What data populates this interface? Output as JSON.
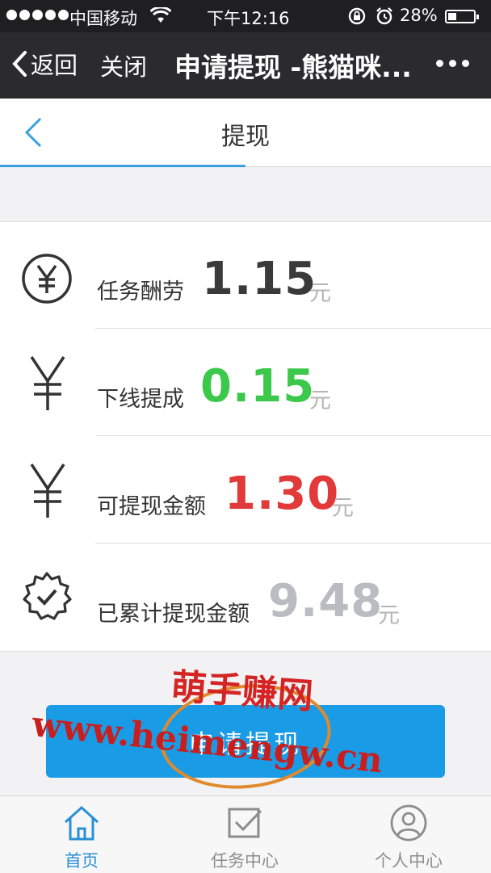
{
  "status_bar": {
    "carrier": "中国移动",
    "time": "下午12:16",
    "battery_percent": "28%",
    "battery_level": 0.28
  },
  "nav": {
    "back_label": "返回",
    "close_label": "关闭",
    "title": "申请提现 -熊猫咪..."
  },
  "page": {
    "title": "提现"
  },
  "rows": [
    {
      "label": "任务酬劳",
      "value": "1.15",
      "unit": "元",
      "icon": "yen-circle-icon",
      "color": "#3a3a3a"
    },
    {
      "label": "下线提成",
      "value": "0.15",
      "unit": "元",
      "icon": "yen-icon",
      "color": "#3cc84a"
    },
    {
      "label": "可提现金额",
      "value": "1.30",
      "unit": "元",
      "icon": "yen-icon",
      "color": "#e2393a"
    },
    {
      "label": "已累计提现金额",
      "value": "9.48",
      "unit": "元",
      "icon": "badge-check-icon",
      "color": "#b9bcc0"
    }
  ],
  "apply_button": {
    "label": "申请提现"
  },
  "watermark": {
    "line1": "萌手赚网",
    "line2": "www.heimengw.cn"
  },
  "tabs": [
    {
      "label": "首页",
      "icon": "home-icon",
      "active": true
    },
    {
      "label": "任务中心",
      "icon": "task-check-icon",
      "active": false
    },
    {
      "label": "个人中心",
      "icon": "user-icon",
      "active": false
    }
  ],
  "colors": {
    "accent": "#1a9be6",
    "tab_active": "#2a8fd4",
    "tab_inactive": "#8d8d8d"
  }
}
